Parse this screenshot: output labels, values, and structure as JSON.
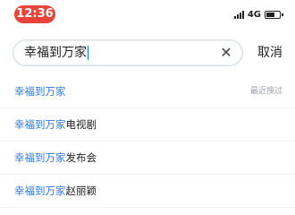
{
  "status": {
    "time": "12:36",
    "network": "4G"
  },
  "search": {
    "value": "幸福到万家",
    "cancel_label": "取消"
  },
  "suggestions": [
    {
      "highlight": "幸福到万家",
      "rest": "",
      "tag": "最近搜过"
    },
    {
      "highlight": "幸福到万家",
      "rest": "电视剧",
      "tag": ""
    },
    {
      "highlight": "幸福到万家",
      "rest": "发布会",
      "tag": ""
    },
    {
      "highlight": "幸福到万家",
      "rest": "赵丽颖",
      "tag": ""
    }
  ],
  "colors": {
    "time_pill": "#e8443a",
    "highlight": "#2c7ae0"
  }
}
